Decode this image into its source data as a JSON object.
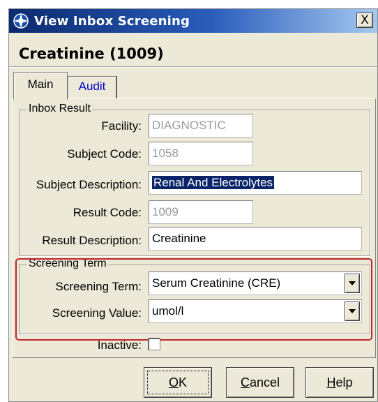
{
  "window": {
    "title": "View Inbox Screening",
    "close_label": "X"
  },
  "header": {
    "title": "Creatinine (1009)"
  },
  "tabs": [
    {
      "label": "Main",
      "active": true
    },
    {
      "label": "Audit",
      "active": false
    }
  ],
  "inbox_result": {
    "group_label": "Inbox Result",
    "facility_label": "Facility:",
    "facility_value": "DIAGNOSTIC",
    "subject_code_label": "Subject Code:",
    "subject_code_value": "1058",
    "subject_description_label": "Subject Description:",
    "subject_description_value": "Renal And Electrolytes",
    "result_code_label": "Result Code:",
    "result_code_value": "1009",
    "result_description_label": "Result Description:",
    "result_description_value": "Creatinine"
  },
  "screening_term": {
    "group_label": "Screening Term",
    "term_label": "Screening Term:",
    "term_value": "Serum Creatinine (CRE)",
    "value_label": "Screening Value:",
    "value_value": "umol/l"
  },
  "inactive": {
    "label": "Inactive:",
    "checked": false
  },
  "buttons": {
    "ok": "OK",
    "cancel": "Cancel",
    "help": "Help"
  },
  "colors": {
    "highlight": "#c0272d",
    "titlebar": "#0b2a6f",
    "selection": "#0a246a"
  }
}
